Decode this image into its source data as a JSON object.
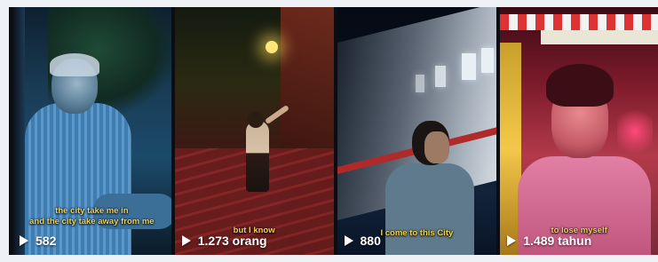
{
  "videos": [
    {
      "caption_lines": [
        "the city take me in",
        "and the city take away from me"
      ],
      "views": "582",
      "play_icon": "play-icon"
    },
    {
      "caption_lines": [
        "but I know"
      ],
      "views": "1.273 orang",
      "play_icon": "play-icon"
    },
    {
      "caption_lines": [
        "I come to this City"
      ],
      "views": "880",
      "play_icon": "play-icon"
    },
    {
      "caption_lines": [
        "to lose myself"
      ],
      "views": "1.489 tahun",
      "play_icon": "play-icon"
    }
  ],
  "colors": {
    "caption": "#f2d24a",
    "view_text": "#ffffff",
    "strip_background": "#0d0d10",
    "page_background": "#eef1f6"
  }
}
